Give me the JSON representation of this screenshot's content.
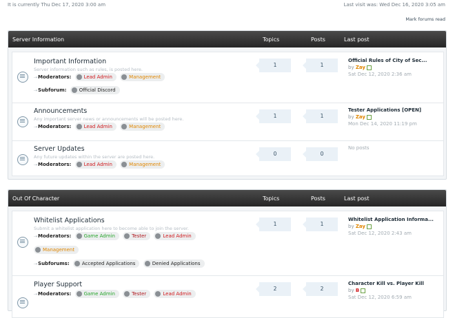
{
  "header": {
    "current_time": "It is currently Thu Dec 17, 2020 3:00 am",
    "last_visit": "Last visit was: Wed Dec 16, 2020 3:05 am",
    "mark_read": "Mark forums read"
  },
  "columns": {
    "topics": "Topics",
    "posts": "Posts",
    "last_post": "Last post"
  },
  "labels": {
    "moderators": "Moderators:",
    "subforum": "Subforum:",
    "subforums": "Subforums:",
    "by": "by",
    "no_posts": "No posts"
  },
  "colors": {
    "lead_admin": "#d0181c",
    "management": "#e08600",
    "game_admin": "#27a52b",
    "tester": "#b0171d",
    "header_bg": "#2e2e2e"
  },
  "categories": [
    {
      "title": "Server Information",
      "forums": [
        {
          "title": "Important Information",
          "desc": "Server information such as rules, is posted here.",
          "mods": [
            {
              "name": "Lead Admin",
              "color": "#d0181c"
            },
            {
              "name": "Management",
              "color": "#e08600"
            }
          ],
          "subforums": [
            {
              "name": "Official Discord"
            }
          ],
          "topics": "1",
          "posts": "1",
          "last": {
            "title": "Official Rules of City of Sec...",
            "user": "Zay",
            "date": "Sat Dec 12, 2020 2:36 am"
          }
        },
        {
          "title": "Announcements",
          "desc": "Any important server news or announcements will be posted here.",
          "mods": [
            {
              "name": "Lead Admin",
              "color": "#d0181c"
            },
            {
              "name": "Management",
              "color": "#e08600"
            }
          ],
          "topics": "1",
          "posts": "1",
          "last": {
            "title": "Tester Applications [OPEN]",
            "user": "Zay",
            "date": "Mon Dec 14, 2020 11:19 pm"
          }
        },
        {
          "title": "Server Updates",
          "desc": "Any future updates within the server are posted here.",
          "mods": [
            {
              "name": "Lead Admin",
              "color": "#d0181c"
            },
            {
              "name": "Management",
              "color": "#e08600"
            }
          ],
          "topics": "0",
          "posts": "0",
          "last": {
            "none": "No posts"
          }
        }
      ]
    },
    {
      "title": "Out Of Character",
      "forums": [
        {
          "title": "Whitelist Applications",
          "desc": "Submit a whitelist application here to become able to join the server.",
          "mods": [
            {
              "name": "Game Admin",
              "color": "#27a52b"
            },
            {
              "name": "Tester",
              "color": "#b0171d"
            },
            {
              "name": "Lead Admin",
              "color": "#d0181c"
            },
            {
              "name": "Management",
              "color": "#e08600"
            }
          ],
          "subforums": [
            {
              "name": "Accepted Applications"
            },
            {
              "name": "Denied Applications"
            }
          ],
          "topics": "1",
          "posts": "1",
          "last": {
            "title": "Whitelist Application Informa...",
            "user": "Zay",
            "date": "Sat Dec 12, 2020 2:43 am"
          }
        },
        {
          "title": "Player Support",
          "mods": [
            {
              "name": "Game Admin",
              "color": "#27a52b"
            },
            {
              "name": "Tester",
              "color": "#b0171d"
            },
            {
              "name": "Lead Admin",
              "color": "#d0181c"
            }
          ],
          "topics": "2",
          "posts": "2",
          "last": {
            "title": "Character Kill vs. Player Kill",
            "user": "B",
            "date": "Sat Dec 12, 2020 6:59 am"
          }
        }
      ]
    }
  ]
}
